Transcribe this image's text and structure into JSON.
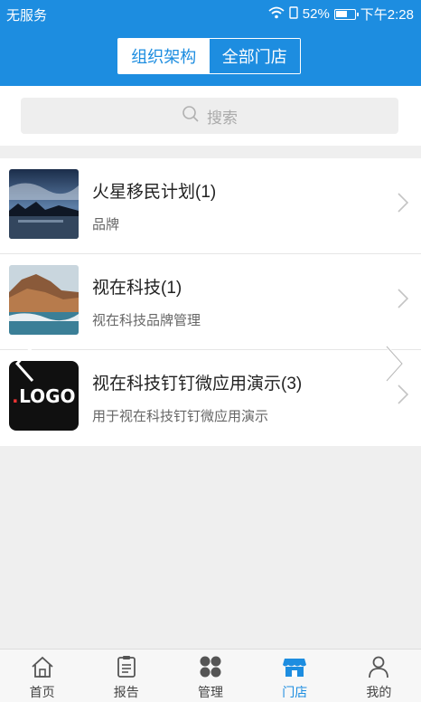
{
  "status_bar": {
    "carrier": "无服务",
    "battery_percent": "52%",
    "time": "下午2:28"
  },
  "segment": {
    "tabs": [
      {
        "label": "组织架构",
        "active": false
      },
      {
        "label": "全部门店",
        "active": true
      }
    ]
  },
  "search": {
    "placeholder": "搜索"
  },
  "stores": [
    {
      "title": "火星移民计划(1)",
      "subtitle": "品牌"
    },
    {
      "title": "视在科技(1)",
      "subtitle": "视在科技品牌管理"
    },
    {
      "title": "视在科技钉钉微应用演示(3)",
      "subtitle": "用于视在科技钉钉微应用演示",
      "logo_text": "LOGO"
    }
  ],
  "tabbar": {
    "items": [
      {
        "label": "首页",
        "icon": "home-icon"
      },
      {
        "label": "报告",
        "icon": "report-icon"
      },
      {
        "label": "管理",
        "icon": "manage-icon"
      },
      {
        "label": "门店",
        "icon": "store-icon",
        "active": true
      },
      {
        "label": "我的",
        "icon": "profile-icon"
      }
    ]
  },
  "colors": {
    "brand": "#1d8de0",
    "background": "#efefef"
  }
}
